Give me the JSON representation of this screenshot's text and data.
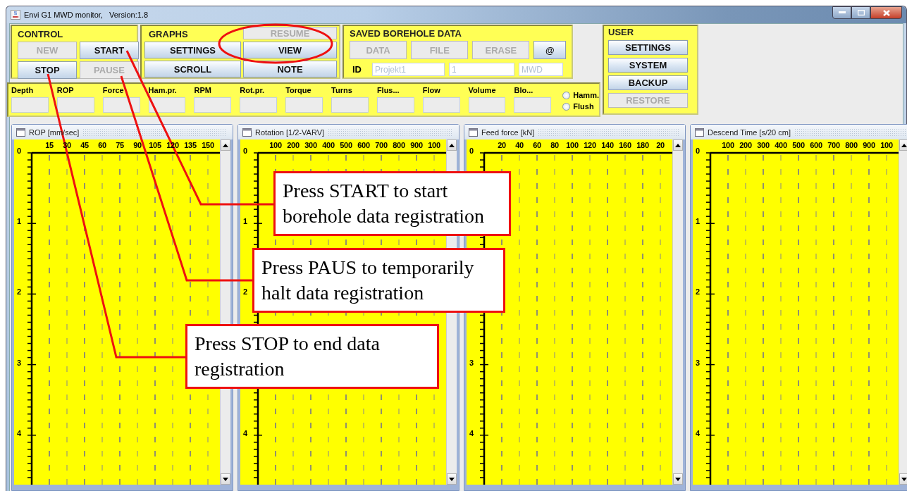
{
  "window": {
    "title": "Envi G1 MWD monitor,   Version:1.8"
  },
  "control": {
    "title": "CONTROL",
    "buttons": [
      {
        "label": "NEW",
        "disabled": true
      },
      {
        "label": "START",
        "disabled": false
      },
      {
        "label": "STOP",
        "disabled": false
      },
      {
        "label": "PAUSE",
        "disabled": true
      }
    ]
  },
  "graphs": {
    "title": "GRAPHS",
    "buttons": [
      {
        "label": "RESUME",
        "disabled": true
      },
      {
        "label": "SETTINGS",
        "disabled": false
      },
      {
        "label": "VIEW",
        "disabled": false
      },
      {
        "label": "SCROLL",
        "disabled": false
      },
      {
        "label": "NOTE",
        "disabled": false
      }
    ]
  },
  "saved": {
    "title": "SAVED BOREHOLE DATA",
    "buttons": [
      {
        "label": "DATA",
        "disabled": true
      },
      {
        "label": "FILE",
        "disabled": true
      },
      {
        "label": "ERASE",
        "disabled": true
      },
      {
        "label": "@",
        "disabled": false
      }
    ],
    "id_label": "ID",
    "fields": [
      {
        "value": "Projekt1",
        "disabled": true
      },
      {
        "value": "1",
        "disabled": true
      },
      {
        "value": "MWD",
        "disabled": true
      }
    ]
  },
  "readings": {
    "fields": [
      {
        "label": "Depth"
      },
      {
        "label": "ROP"
      },
      {
        "label": "Force"
      },
      {
        "label": "Ham.pr."
      },
      {
        "label": "RPM"
      },
      {
        "label": "Rot.pr."
      },
      {
        "label": "Torque"
      },
      {
        "label": "Turns"
      },
      {
        "label": "Flus..."
      },
      {
        "label": "Flow"
      },
      {
        "label": "Volume"
      },
      {
        "label": "Blo..."
      }
    ],
    "radios": [
      {
        "label": "Hamm.",
        "selected": false
      },
      {
        "label": "Flush",
        "selected": false
      }
    ]
  },
  "user": {
    "title": "USER",
    "buttons": [
      {
        "label": "SETTINGS",
        "disabled": false
      },
      {
        "label": "SYSTEM",
        "disabled": false
      },
      {
        "label": "BACKUP",
        "disabled": false
      },
      {
        "label": "RESTORE",
        "disabled": true
      }
    ]
  },
  "charts": [
    {
      "title": "ROP [mm/sec]",
      "chart_data": {
        "type": "line",
        "xticks": [
          15,
          30,
          45,
          60,
          75,
          90,
          105,
          120,
          135,
          150
        ],
        "yticks": [
          0,
          1,
          2,
          3,
          4
        ],
        "xlim": [
          0,
          150
        ],
        "ylim": [
          4.7,
          0
        ],
        "grid": true
      }
    },
    {
      "title": "Rotation [1/2-VARV]",
      "edge_label": "100",
      "chart_data": {
        "type": "line",
        "xticks": [
          100,
          200,
          300,
          400,
          500,
          600,
          700,
          800,
          900
        ],
        "yticks": [
          0,
          1,
          2,
          4
        ],
        "xlim": [
          0,
          1000
        ],
        "ylim": [
          4.7,
          0
        ],
        "grid": true
      }
    },
    {
      "title": "Feed force [kN]",
      "edge_label": "20",
      "chart_data": {
        "type": "line",
        "xticks": [
          20,
          40,
          60,
          80,
          100,
          120,
          140,
          160,
          180
        ],
        "yticks": [
          0,
          3,
          4
        ],
        "xlim": [
          0,
          200
        ],
        "ylim": [
          4.7,
          0
        ],
        "grid": true
      }
    },
    {
      "title": "Descend Time [s/20 cm]",
      "edge_label": "100",
      "chart_data": {
        "type": "line",
        "xticks": [
          100,
          200,
          300,
          400,
          500,
          600,
          700,
          800,
          900
        ],
        "yticks": [
          0,
          1,
          2,
          3,
          4
        ],
        "xlim": [
          0,
          1000
        ],
        "ylim": [
          4.7,
          0
        ],
        "grid": true
      }
    }
  ],
  "callouts": [
    {
      "text": "Press START to start borehole data registration"
    },
    {
      "text": "Press PAUS to temporarily halt data registration"
    },
    {
      "text": "Press STOP to end data registration"
    }
  ]
}
